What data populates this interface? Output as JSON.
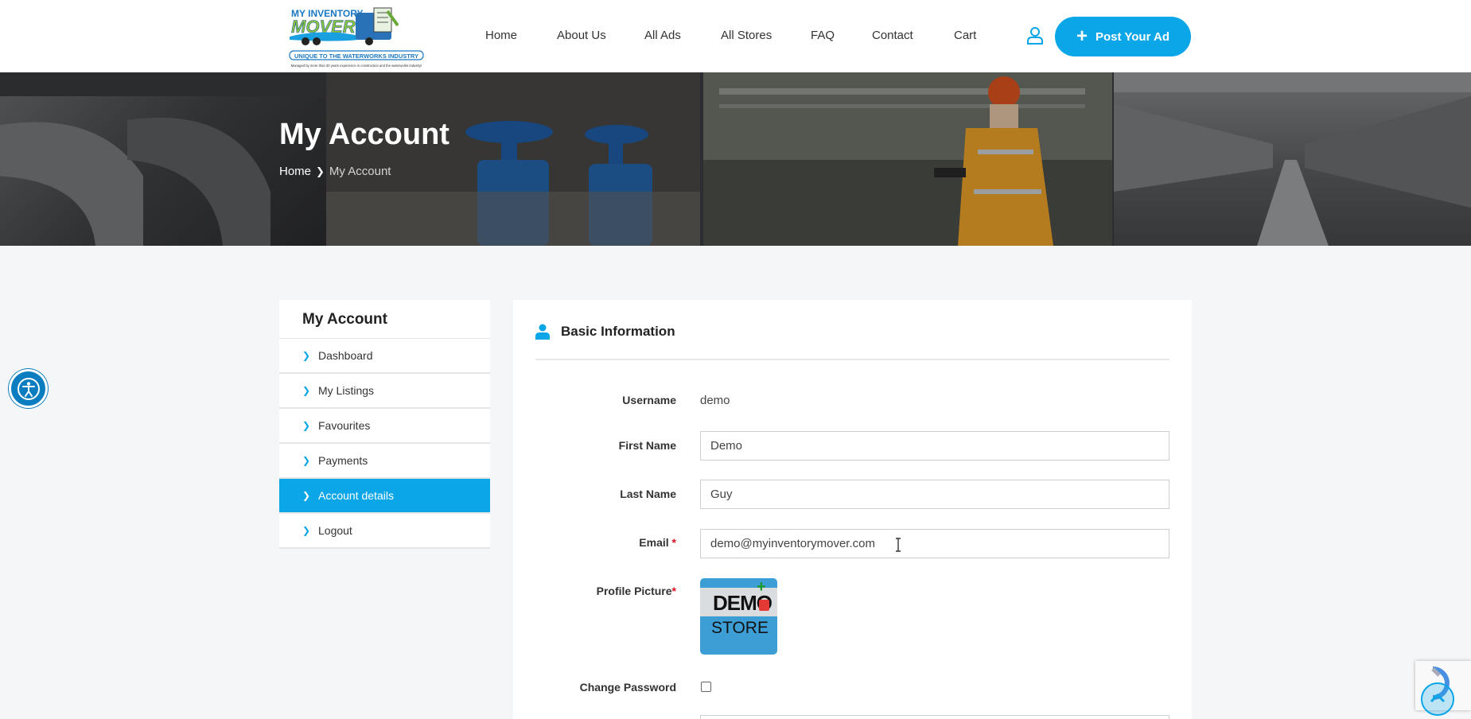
{
  "logo": {
    "line1": "MY INVENTORY",
    "line2": "MOVER",
    "tagline": "UNIQUE TO THE WATERWORKS INDUSTRY",
    "subline": "Managed by more than 30 years experience in construction and the waterworks industry!"
  },
  "nav": {
    "items": [
      "Home",
      "About Us",
      "All Ads",
      "All Stores",
      "FAQ",
      "Contact",
      "Cart"
    ],
    "user_icon": "user-icon",
    "post_label": "Post Your Ad"
  },
  "hero": {
    "title": "My Account",
    "breadcrumb_home": "Home",
    "breadcrumb_current": "My Account"
  },
  "sidebar": {
    "title": "My Account",
    "items": [
      {
        "label": "Dashboard",
        "active": false
      },
      {
        "label": "My Listings",
        "active": false
      },
      {
        "label": "Favourites",
        "active": false
      },
      {
        "label": "Payments",
        "active": false
      },
      {
        "label": "Account details",
        "active": true
      },
      {
        "label": "Logout",
        "active": false
      }
    ]
  },
  "form": {
    "section_title": "Basic Information",
    "username_label": "Username",
    "username_value": "demo",
    "first_name_label": "First Name",
    "first_name_value": "Demo",
    "last_name_label": "Last Name",
    "last_name_value": "Guy",
    "email_label": "Email",
    "email_value": "demo@myinventorymover.com",
    "required_mark": "*",
    "profile_picture_label": "Profile Picture",
    "avatar_text1": "DEMO",
    "avatar_text2": "STORE",
    "change_password_label": "Change Password"
  },
  "colors": {
    "accent": "#0aa6e8",
    "required": "#dd1122",
    "a11y": "#0a7cc0"
  }
}
